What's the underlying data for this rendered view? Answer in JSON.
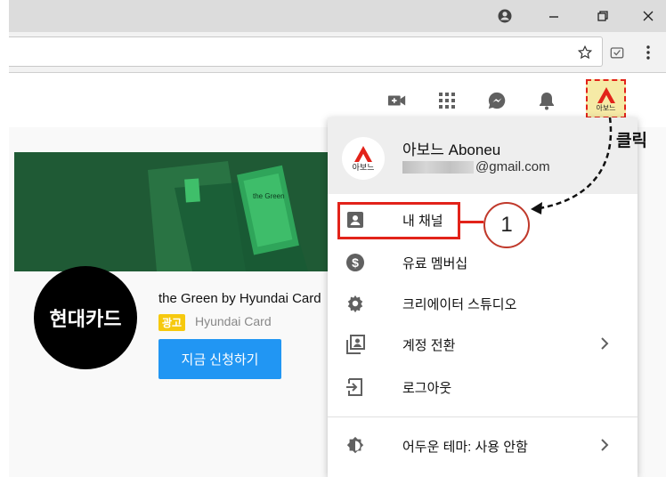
{
  "window": {
    "account_icon": "account-circle-icon",
    "minimize_icon": "minimize-icon",
    "restore_icon": "restore-icon",
    "close_icon": "close-icon"
  },
  "toolbar": {
    "star_icon": "star-icon",
    "extension_icon": "extension-icon",
    "menu_icon": "more-vert-icon"
  },
  "header": {
    "icons": [
      "create-video-icon",
      "apps-icon",
      "messages-icon",
      "notifications-icon"
    ],
    "avatar_text": "아보느"
  },
  "ad": {
    "title": "the Green by Hyundai Card",
    "badge": "광고",
    "advertiser": "Hyundai Card",
    "logo_text": "현대카드",
    "cta_label": "지금 신청하기",
    "banner_text": "the Green"
  },
  "menu": {
    "avatar_text": "아보느",
    "name": "아보느 Aboneu",
    "email_suffix": "@gmail.com",
    "items": [
      {
        "label": "내 채널",
        "icon": "account-box-icon",
        "chevron": false
      },
      {
        "label": "유료 멤버십",
        "icon": "dollar-icon",
        "chevron": false
      },
      {
        "label": "크리에이터 스튜디오",
        "icon": "gear-icon",
        "chevron": false
      },
      {
        "label": "계정 전환",
        "icon": "switch-account-icon",
        "chevron": true
      },
      {
        "label": "로그아웃",
        "icon": "logout-icon",
        "chevron": false
      },
      {
        "label": "어두운 테마: 사용 안함",
        "icon": "dark-theme-icon",
        "chevron": true
      }
    ]
  },
  "annotations": {
    "step_number": "1",
    "click_label": "클릭"
  },
  "colors": {
    "youtube_red": "#e2231a",
    "cta_blue": "#2196f3",
    "badge_yellow": "#f6c90e"
  }
}
